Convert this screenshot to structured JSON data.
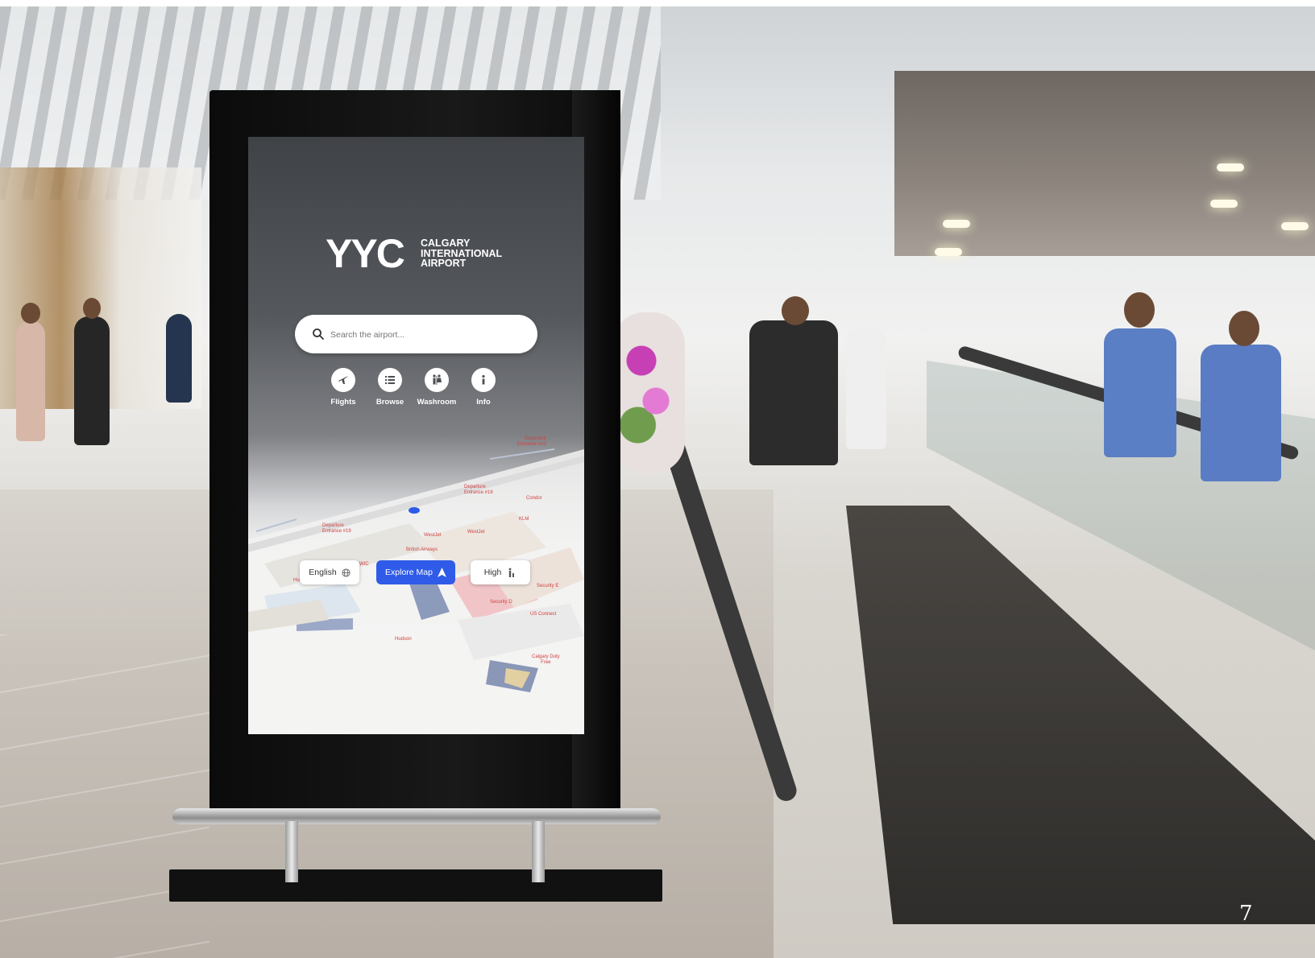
{
  "kiosk": {
    "brand_mark": "YYC",
    "brand_name": [
      "CALGARY",
      "INTERNATIONAL",
      "AIRPORT"
    ],
    "search": {
      "placeholder": "Search the airport..."
    },
    "quick_actions": [
      {
        "label": "Flights",
        "icon": "plane-icon"
      },
      {
        "label": "Browse",
        "icon": "list-icon"
      },
      {
        "label": "Washroom",
        "icon": "washroom-icon"
      },
      {
        "label": "Info",
        "icon": "info-icon"
      }
    ],
    "map_labels": {
      "departure_10": [
        "Departure",
        "Entrance #10"
      ],
      "departure_16": [
        "Departure",
        "Entrance #16"
      ],
      "departure_19": [
        "Departure",
        "Entrance #19"
      ],
      "condor": "Condor",
      "klm": "KLM",
      "westjet_1": "WestJet",
      "westjet_2": "WestJet",
      "british_airways": "British Airways",
      "hudson_1": "Hudson",
      "hudson_2": "Hudson",
      "security_e": "Security E",
      "security_d": "Security D",
      "us_connect": "US Connect",
      "duty_free": [
        "Calgary Duty",
        "Free"
      ],
      "wic": "WIC"
    },
    "controls": {
      "language": "English",
      "explore": "Explore Map",
      "contrast": "High"
    },
    "colors": {
      "accent": "#2f5be8",
      "map_label": "#d04040"
    }
  },
  "page_number": "7"
}
